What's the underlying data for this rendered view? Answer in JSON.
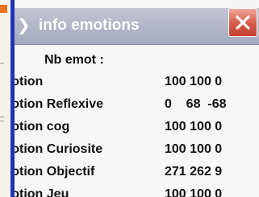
{
  "window": {
    "title": "info emotions",
    "title_icon": "arrow-icon",
    "close_icon": "close-icon",
    "titlebar_color": "#b4b7c9",
    "close_color": "#d65a48"
  },
  "content": {
    "heading": "Nb emot :",
    "rows": [
      {
        "label": "motion",
        "values": "100 100 0"
      },
      {
        "label": "motion Reflexive",
        "values": "0    68  -68"
      },
      {
        "label": "motion cog",
        "values": "100 100 0"
      },
      {
        "label": "motion Curiosite",
        "values": "100 100 0"
      },
      {
        "label": "motion Objectif",
        "values": "271 262 9"
      },
      {
        "label": "motion Jeu",
        "values": "100 100 0"
      }
    ]
  }
}
